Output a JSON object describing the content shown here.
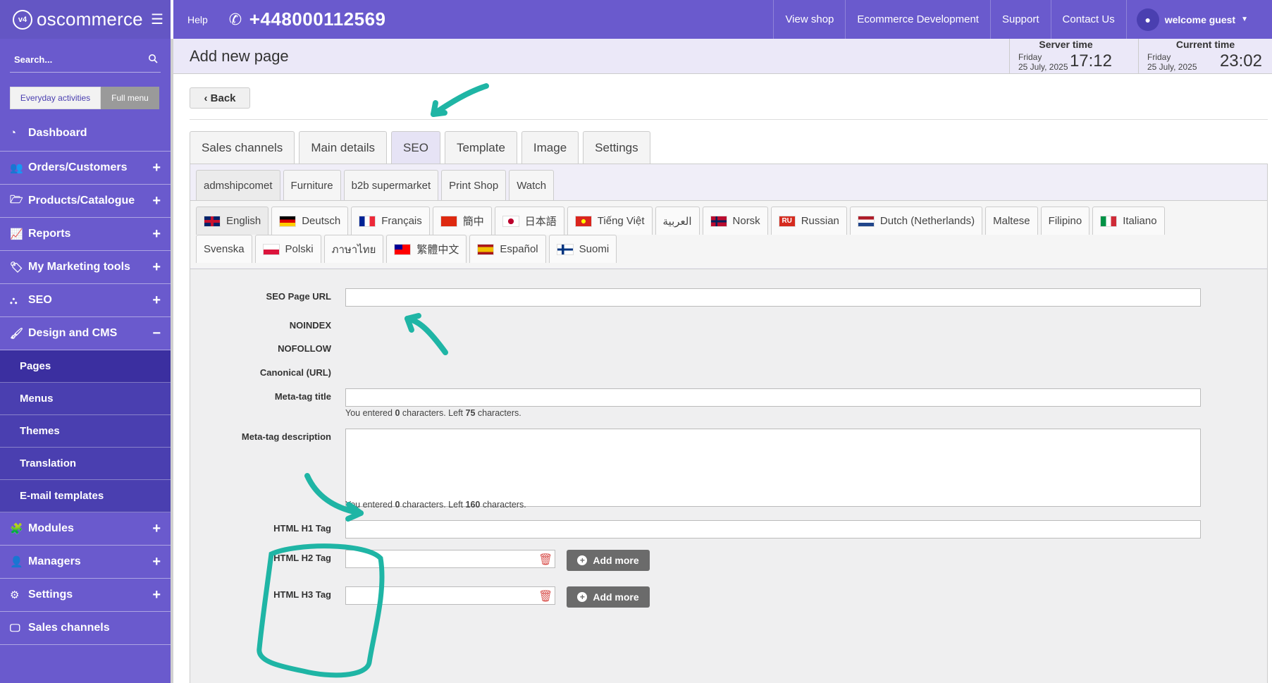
{
  "sidebar": {
    "brand": "oscommerce",
    "logo_badge": "v4",
    "search_placeholder": "Search...",
    "switch": {
      "a": "Everyday activities",
      "b": "Full menu"
    },
    "menu": [
      {
        "label": "Dashboard",
        "icon": "dashboard-icon",
        "toggle": ""
      },
      {
        "label": "Orders/Customers",
        "icon": "users-icon",
        "toggle": "+"
      },
      {
        "label": "Products/Catalogue",
        "icon": "folder-icon",
        "toggle": "+"
      },
      {
        "label": "Reports",
        "icon": "chart-icon",
        "toggle": "+"
      },
      {
        "label": "My Marketing tools",
        "icon": "tag-icon",
        "toggle": "+"
      },
      {
        "label": "SEO",
        "icon": "sitemap-icon",
        "toggle": "+"
      },
      {
        "label": "Design and CMS",
        "icon": "brush-icon",
        "toggle": "−"
      }
    ],
    "submenu": [
      "Pages",
      "Menus",
      "Themes",
      "Translation",
      "E-mail templates"
    ],
    "menu2": [
      {
        "label": "Modules",
        "icon": "puzzle-icon",
        "toggle": "+"
      },
      {
        "label": "Managers",
        "icon": "user-icon",
        "toggle": "+"
      },
      {
        "label": "Settings",
        "icon": "gears-icon",
        "toggle": "+"
      },
      {
        "label": "Sales channels",
        "icon": "monitor-icon",
        "toggle": ""
      }
    ]
  },
  "topbar": {
    "help": "Help",
    "phone": "+448000112569",
    "nav": [
      "View shop",
      "Ecommerce Development",
      "Support",
      "Contact Us"
    ],
    "user": "welcome guest"
  },
  "header": {
    "title": "Add new page",
    "server_time": {
      "title": "Server time",
      "day": "Friday",
      "date": "25 July, 2025",
      "clock": "17:12"
    },
    "current_time": {
      "title": "Current time",
      "day": "Friday",
      "date": "25 July, 2025",
      "clock": "23:02"
    }
  },
  "content": {
    "back": "‹ Back",
    "main_tabs": [
      "Sales channels",
      "Main details",
      "SEO",
      "Template",
      "Image",
      "Settings"
    ],
    "channel_tabs": [
      "admshipcomet",
      "Furniture",
      "b2b supermarket",
      "Print Shop",
      "Watch"
    ],
    "languages_row1": [
      "English",
      "Deutsch",
      "Français",
      "簡中",
      "日本語",
      "Tiếng Việt",
      "العربية",
      "Norsk",
      "Russian",
      "Dutch (Netherlands)",
      "Maltese",
      "Filipino",
      "Italiano"
    ],
    "languages_row2": [
      "Svenska",
      "Polski",
      "ภาษาไทย",
      "繁體中文",
      "Español",
      "Suomi"
    ],
    "form": {
      "seo_url": "SEO Page URL",
      "noindex": "NOINDEX",
      "nofollow": "NOFOLLOW",
      "canonical": "Canonical (URL)",
      "meta_title": "Meta-tag title",
      "meta_title_help": {
        "a": "You entered ",
        "count": "0",
        "b": " characters. Left ",
        "left": "75",
        "c": " characters."
      },
      "meta_desc": "Meta-tag description",
      "meta_desc_help": {
        "a": "You entered ",
        "count": "0",
        "b": " characters. Left ",
        "left": "160",
        "c": " characters."
      },
      "h1": "HTML H1 Tag",
      "h2": "HTML H2 Tag",
      "h3": "HTML H3 Tag",
      "add_more": "Add more"
    }
  },
  "colors": {
    "accent": "#6a5acd",
    "submenu": "#4a3fb0",
    "annotation": "#1fb5a5"
  }
}
